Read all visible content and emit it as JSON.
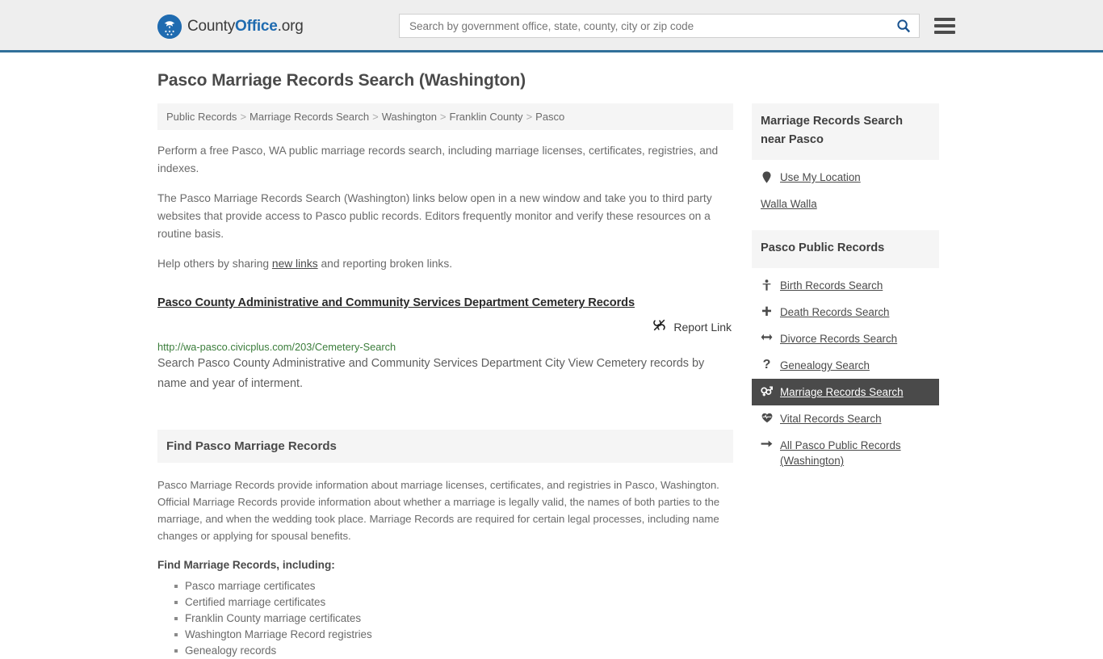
{
  "header": {
    "logo": {
      "icon": "eagle-shield-logo-icon",
      "part1": "County",
      "part2": "Office",
      "part3": ".org"
    },
    "search": {
      "placeholder": "Search by government office, state, county, city or zip code",
      "value": "",
      "search_icon": "search-icon"
    },
    "menu_icon": "hamburger-menu-icon",
    "accent_color": "#31709a",
    "background_color": "#eeeeee"
  },
  "page": {
    "title": "Pasco Marriage Records Search (Washington)"
  },
  "breadcrumb": {
    "separator": ">",
    "items": [
      {
        "label": "Public Records"
      },
      {
        "label": "Marriage Records Search"
      },
      {
        "label": "Washington"
      },
      {
        "label": "Franklin County"
      },
      {
        "label": "Pasco"
      }
    ]
  },
  "intro": {
    "p1": "Perform a free Pasco, WA public marriage records search, including marriage licenses, certificates, registries, and indexes.",
    "p2": "The Pasco Marriage Records Search (Washington) links below open in a new window and take you to third party websites that provide access to Pasco public records. Editors frequently monitor and verify these resources on a routine basis.",
    "p3_before": "Help others by sharing ",
    "p3_link": "new links",
    "p3_after": " and reporting broken links."
  },
  "result": {
    "title": "Pasco County Administrative and Community Services Department Cemetery Records",
    "report_icon": "broken-link-icon",
    "report_label": "Report Link",
    "url": "http://wa-pasco.civicplus.com/203/Cemetery-Search",
    "url_color": "#3b7d3b",
    "description": "Search Pasco County Administrative and Community Services Department City View Cemetery records by name and year of interment."
  },
  "find_section": {
    "heading": "Find Pasco Marriage Records",
    "body": "Pasco Marriage Records provide information about marriage licenses, certificates, and registries in Pasco, Washington. Official Marriage Records provide information about whether a marriage is legally valid, the names of both parties to the marriage, and when the wedding took place. Marriage Records are required for certain legal processes, including name changes or applying for spousal benefits.",
    "subheading": "Find Marriage Records, including:",
    "bullets": [
      "Pasco marriage certificates",
      "Certified marriage certificates",
      "Franklin County marriage certificates",
      "Washington Marriage Record registries",
      "Genealogy records"
    ]
  },
  "sidebar": {
    "near_panel": {
      "heading": "Marriage Records Search near Pasco",
      "location_icon": "map-pin-icon",
      "location_label": "Use My Location",
      "places": [
        {
          "label": "Walla Walla"
        }
      ]
    },
    "records_panel": {
      "heading": "Pasco Public Records",
      "active_background": "#4a4a4a",
      "items": [
        {
          "label": "Birth Records Search",
          "icon": "baby-icon",
          "glyph": "A",
          "active": false
        },
        {
          "label": "Death Records Search",
          "icon": "cross-icon",
          "glyph": "+",
          "active": false
        },
        {
          "label": "Divorce Records Search",
          "icon": "arrows-left-right-icon",
          "glyph": "↔",
          "active": false
        },
        {
          "label": "Genealogy Search",
          "icon": "question-mark-icon",
          "glyph": "?",
          "active": false
        },
        {
          "label": "Marriage Records Search",
          "icon": "venus-mars-icon",
          "glyph": "⚤",
          "active": true
        },
        {
          "label": "Vital Records Search",
          "icon": "heart-pulse-icon",
          "glyph": "♥",
          "active": false
        },
        {
          "label": "All Pasco Public Records (Washington)",
          "icon": "arrow-right-icon",
          "glyph": "→",
          "active": false
        }
      ]
    }
  }
}
